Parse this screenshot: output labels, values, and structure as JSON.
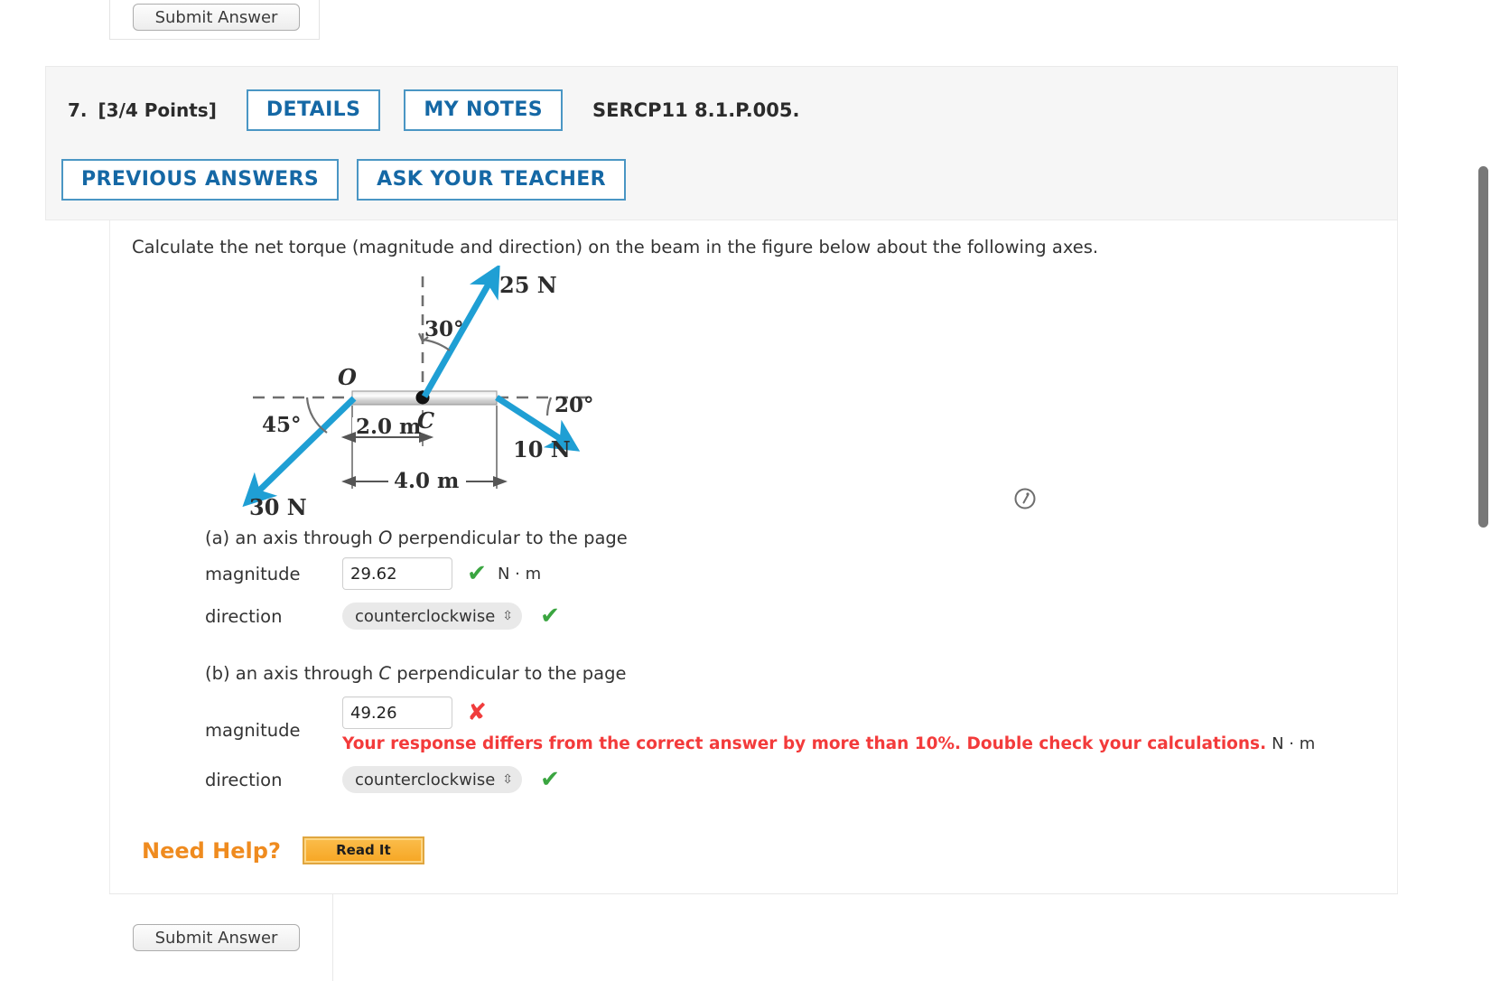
{
  "top_panel": {
    "submit_label": "Submit Answer"
  },
  "question": {
    "number": "7.",
    "points": "[3/4 Points]",
    "details_label": "DETAILS",
    "my_notes_label": "MY NOTES",
    "code": "SERCP11 8.1.P.005.",
    "previous_answers_label": "PREVIOUS ANSWERS",
    "ask_your_teacher_label": "ASK YOUR TEACHER",
    "prompt": "Calculate the net torque (magnitude and direction) on the beam in the figure below about the following axes."
  },
  "figure": {
    "info_icon": "info-icon",
    "labels": {
      "force_25": "25 N",
      "force_30": "30 N",
      "force_10": "10 N",
      "angle_30": "30°",
      "angle_45": "45°",
      "angle_20": "20°",
      "point_O": "O",
      "point_C": "C",
      "dim_2m": "2.0 m",
      "dim_4m": "4.0 m"
    },
    "colors": {
      "arrow_blue": "#1f9fd4",
      "beam_gray": "#c9c9c9",
      "dashed_gray": "#7a7a7a"
    }
  },
  "parts": [
    {
      "id": "a",
      "label_prefix": "(a) an axis through ",
      "label_var": "O",
      "label_suffix": " perpendicular to the page",
      "magnitude_key": "magnitude",
      "magnitude_value": "29.62",
      "magnitude_status": "correct",
      "magnitude_mark": "✔",
      "units": "N · m",
      "direction_key": "direction",
      "direction_value": "counterclockwise",
      "direction_status": "correct",
      "direction_mark": "✔",
      "error_message": ""
    },
    {
      "id": "b",
      "label_prefix": "(b) an axis through ",
      "label_var": "C",
      "label_suffix": " perpendicular to the page",
      "magnitude_key": "magnitude",
      "magnitude_value": "49.26",
      "magnitude_status": "incorrect",
      "magnitude_mark": "✘",
      "units": "N · m",
      "direction_key": "direction",
      "direction_value": "counterclockwise",
      "direction_status": "correct",
      "direction_mark": "✔",
      "error_message": "Your response differs from the correct answer by more than 10%. Double check your calculations."
    }
  ],
  "need_help": {
    "label": "Need Help?",
    "read_it_label": "Read It"
  },
  "bottom_panel": {
    "submit_label": "Submit Answer"
  },
  "colors": {
    "link_blue": "#1568a5",
    "border_blue": "#4a96c4",
    "correct_green": "#3aa540",
    "incorrect_red": "#f03c3c",
    "error_red": "#f33b3b",
    "help_orange": "#ef8b1f",
    "header_bg": "#f6f6f6"
  }
}
